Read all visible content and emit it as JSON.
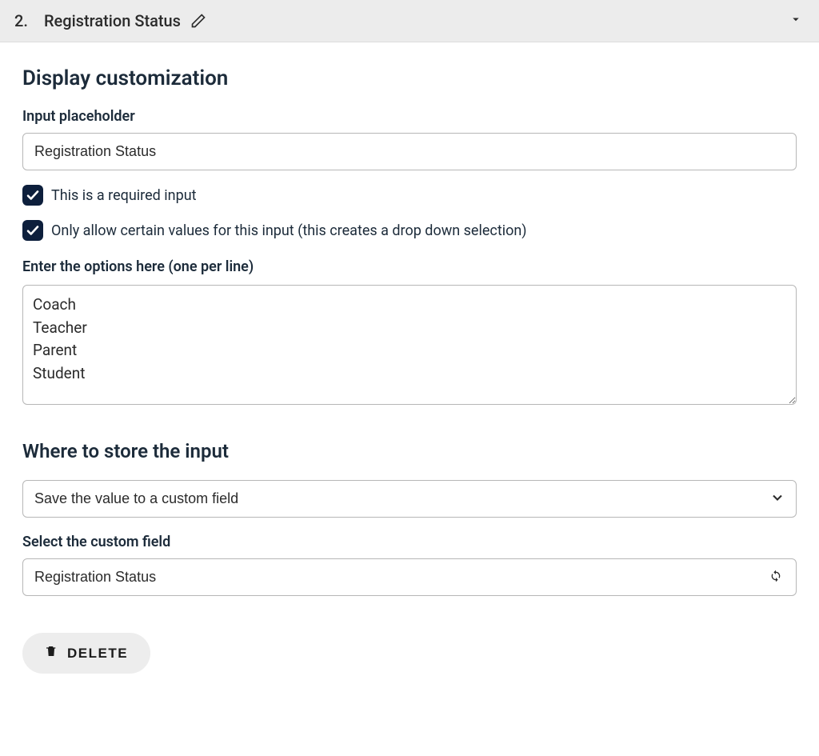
{
  "header": {
    "number": "2.",
    "title": "Registration Status"
  },
  "display": {
    "section_title": "Display customization",
    "placeholder_label": "Input placeholder",
    "placeholder_value": "Registration Status",
    "required_label": "This is a required input",
    "dropdown_label": "Only allow certain values for this input (this creates a drop down selection)",
    "options_label": "Enter the options here (one per line)",
    "options_value": "Coach\nTeacher\nParent\nStudent"
  },
  "storage": {
    "section_title": "Where to store the input",
    "store_select_value": "Save the value to a custom field",
    "custom_field_label": "Select the custom field",
    "custom_field_value": "Registration Status"
  },
  "actions": {
    "delete_label": "DELETE"
  }
}
